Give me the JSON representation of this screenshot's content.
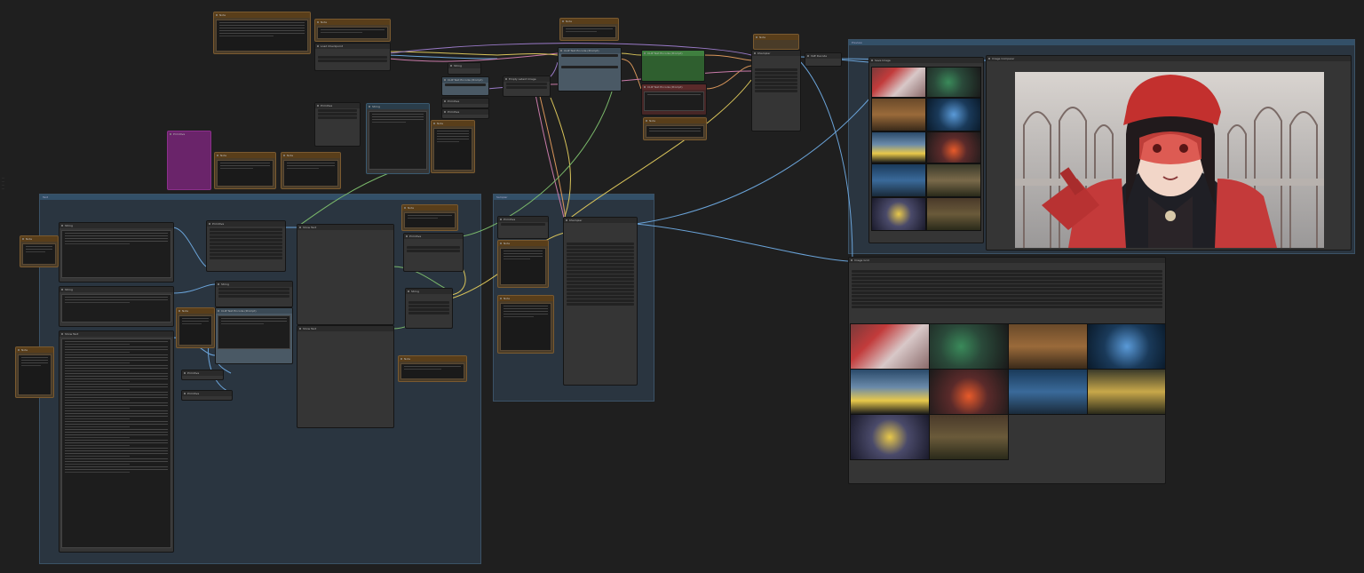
{
  "app": {
    "name": "ComfyUI",
    "background_color": "#1f1f1f"
  },
  "colors": {
    "wire_yellow": "#d9c45a",
    "wire_blue": "#6aa3d8",
    "wire_pink": "#c87aa8",
    "wire_green": "#7ab86a",
    "wire_orange": "#d8955a",
    "wire_purple": "#9a7ac8",
    "group_blue": "#2a3540",
    "note_brown": "#593e1a",
    "primitive_purple": "#6a246a",
    "sampler_green": "#3f7f3f"
  },
  "canvas": {
    "sidebar_labels": [
      "...",
      "...",
      "...",
      "..."
    ]
  },
  "groups": {
    "text_group": "Text",
    "mid_group": "Sampler",
    "preview_group": "Preview"
  },
  "nodes": {
    "note": "Note",
    "load_checkpoint": "Load Checkpoint",
    "clip_text_encode": "CLIP Text Encode (Prompt)",
    "ksampler": "KSampler",
    "vae_decode": "VAE Decode",
    "save_image": "Save Image",
    "preview_image": "Preview Image",
    "image_grid": "Image Grid",
    "primitive": "Primitive",
    "string": "String",
    "show_text": "Show Text",
    "image_comparer": "Image Comparer",
    "upscale": "Upscale Image",
    "empty_latent": "Empty Latent Image"
  },
  "icons": {
    "node_dot": "dot-icon",
    "image": "image-icon",
    "gear": "gear-icon"
  }
}
